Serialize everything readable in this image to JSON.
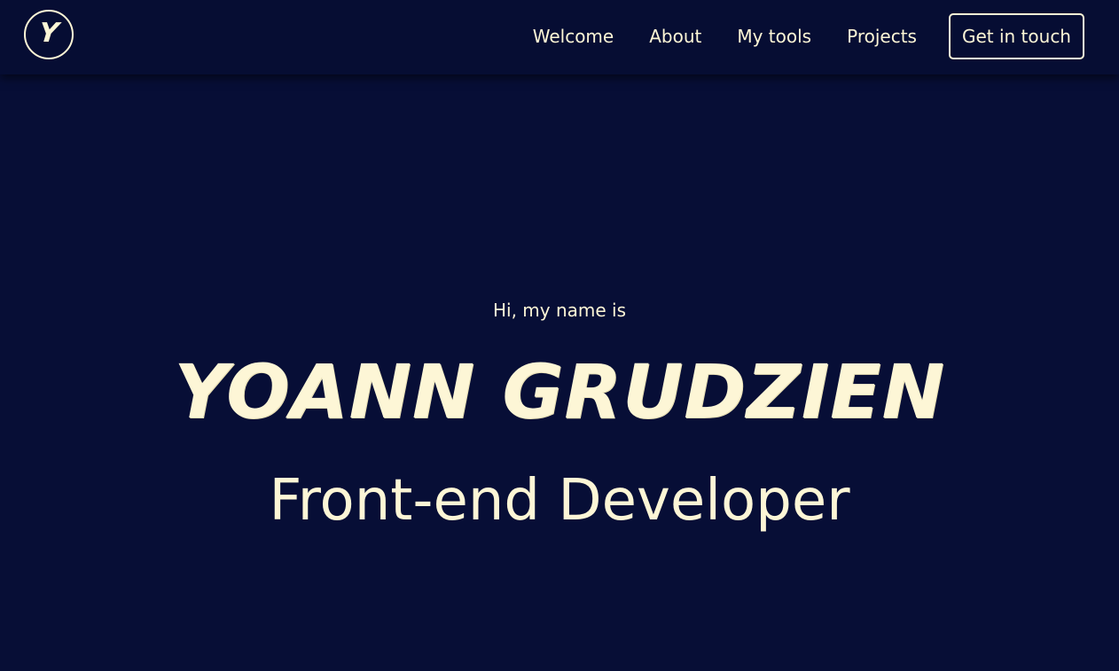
{
  "header": {
    "logo_letter": "Y",
    "nav": {
      "welcome": "Welcome",
      "about": "About",
      "tools": "My tools",
      "projects": "Projects"
    },
    "cta_label": "Get in touch"
  },
  "hero": {
    "greeting": "Hi, my name is",
    "name": "YOANN GRUDZIEN",
    "role": "Front-end Developer"
  },
  "colors": {
    "background": "#070e36",
    "text": "#fdf6d6"
  }
}
